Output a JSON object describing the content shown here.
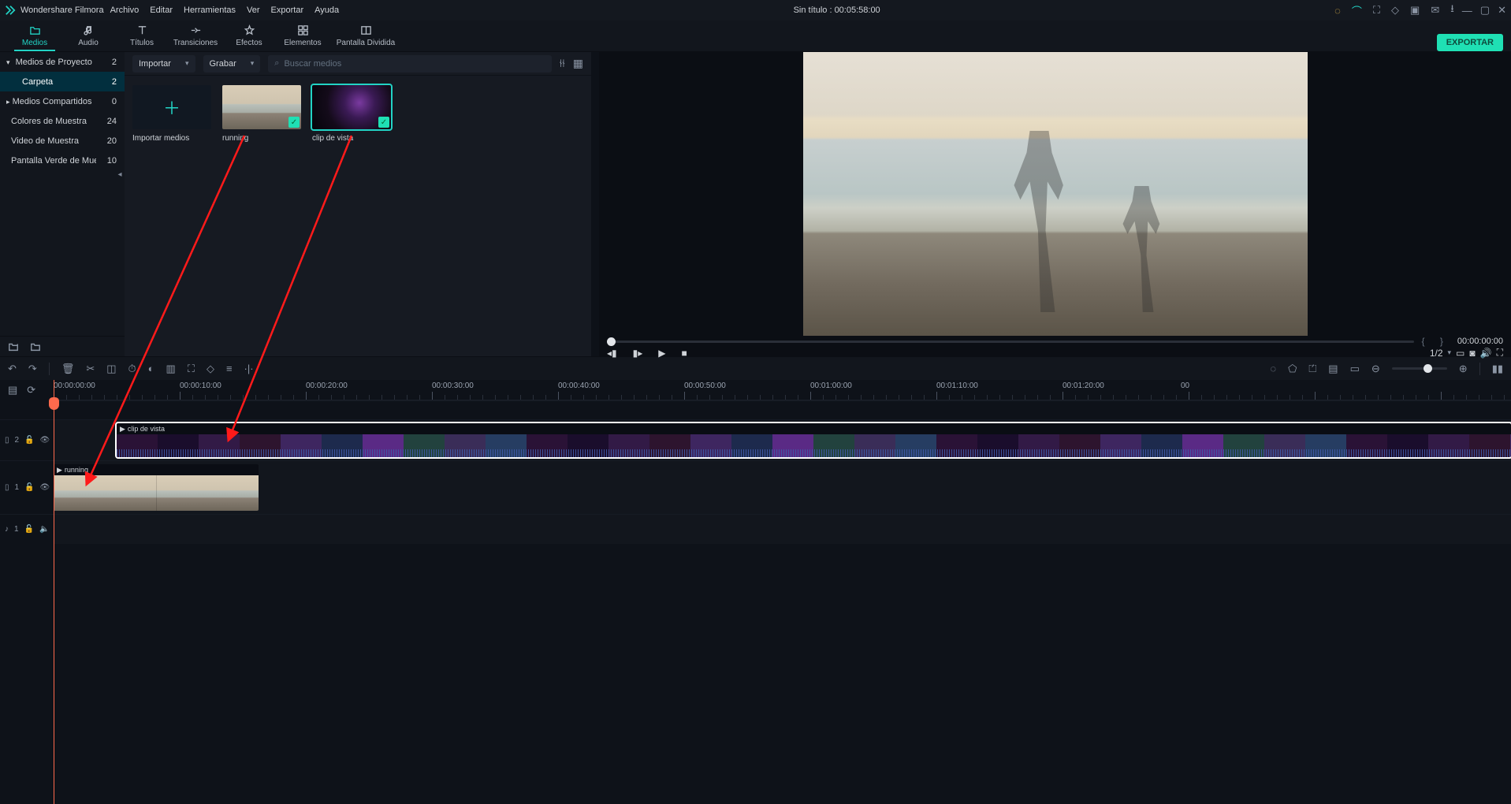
{
  "app_name": "Wondershare Filmora",
  "doc_title": "Sin título : 00:05:58:00",
  "menus": [
    "Archivo",
    "Editar",
    "Herramientas",
    "Ver",
    "Exportar",
    "Ayuda"
  ],
  "tabs": [
    {
      "label": "Medios"
    },
    {
      "label": "Audio"
    },
    {
      "label": "Títulos"
    },
    {
      "label": "Transiciones"
    },
    {
      "label": "Efectos"
    },
    {
      "label": "Elementos"
    },
    {
      "label": "Pantalla Dividida"
    }
  ],
  "export_label": "EXPORTAR",
  "sidebar": {
    "items": [
      {
        "label": "Medios de Proyecto",
        "count": "2"
      },
      {
        "label": "Carpeta",
        "count": "2"
      },
      {
        "label": "Medios Compartidos",
        "count": "0"
      },
      {
        "label": "Colores de Muestra",
        "count": "24"
      },
      {
        "label": "Video de Muestra",
        "count": "20"
      },
      {
        "label": "Pantalla Verde de Mue",
        "count": "10"
      }
    ]
  },
  "media_bar": {
    "import_label": "Importar",
    "record_label": "Grabar",
    "search_placeholder": "Buscar medios"
  },
  "media": {
    "import_caption": "Importar medios",
    "clip1": "running",
    "clip2": "clip de vista"
  },
  "preview": {
    "time_start": "00:00:00:00",
    "page": "1/2"
  },
  "ruler_labels": [
    "00:00:00:00",
    "00:00:10:00",
    "00:00:20:00",
    "00:00:30:00",
    "00:00:40:00",
    "00:00:50:00",
    "00:01:00:00",
    "00:01:10:00",
    "00:01:20:00",
    "00"
  ],
  "tracks": {
    "t2": "2",
    "t1": "1",
    "a1": "1"
  },
  "clips": {
    "vista": "clip de vista",
    "running": "running"
  }
}
